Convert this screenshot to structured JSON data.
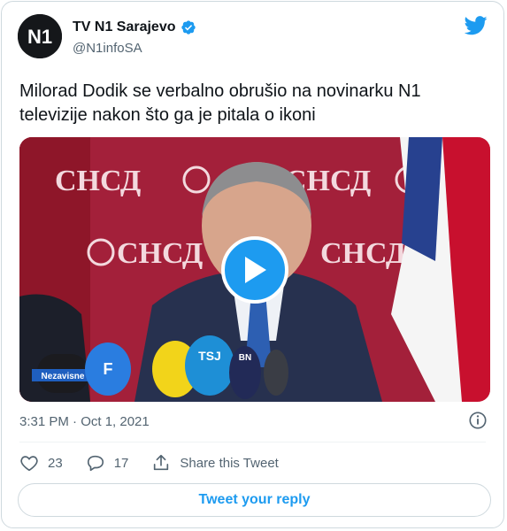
{
  "author": {
    "display_name": "TV N1 Sarajevo",
    "handle": "@N1infoSA",
    "avatar_text": "N1",
    "verified": true
  },
  "tweet": {
    "text": "Milorad Dodik se verbalno obrušio na novinarku N1 televizije nakon što ga je pitala o ikoni",
    "time": "3:31 PM · Oct 1, 2021"
  },
  "media": {
    "type": "video",
    "backdrop_text": "СНСД",
    "mic_labels": [
      "Nezavisne",
      "F",
      "TSJ",
      "BN"
    ]
  },
  "actions": {
    "likes": "23",
    "replies": "17",
    "share_label": "Share this Tweet"
  },
  "reply_button_label": "Tweet your reply",
  "colors": {
    "accent": "#1d9bf0",
    "text": "#0f1419",
    "secondary": "#536471",
    "border": "#cfd9de",
    "backdrop": "#a3203a"
  },
  "icons": [
    "verified-badge-icon",
    "twitter-bird-icon",
    "play-icon",
    "info-icon",
    "heart-icon",
    "reply-icon",
    "share-icon"
  ]
}
